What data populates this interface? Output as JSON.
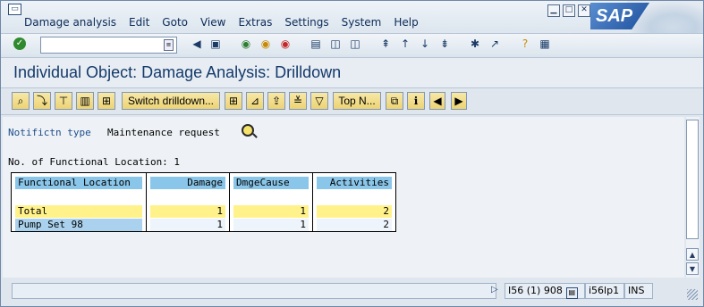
{
  "menu": [
    "Damage analysis",
    "Edit",
    "Goto",
    "View",
    "Extras",
    "Settings",
    "System",
    "Help"
  ],
  "window": {
    "minimize": "▁",
    "maximize": "□",
    "close": "✕"
  },
  "logo": "SAP",
  "title": "Individual Object: Damage Analysis: Drilldown",
  "toolbar": {
    "buttons": [
      "Switch drilldown...",
      "Top N..."
    ]
  },
  "notification": {
    "label": "Notifictn type",
    "value": "Maintenance request"
  },
  "count_text": "No. of Functional Location: 1",
  "table": {
    "headers": [
      "Functional Location",
      "Damage",
      "DmgeCause",
      "Activities"
    ],
    "rows": [
      {
        "label": "Total",
        "values": [
          "1",
          "1",
          "2"
        ]
      },
      {
        "label": "Pump Set 98",
        "values": [
          "1",
          "1",
          "2"
        ]
      }
    ]
  },
  "status": {
    "system": "I56 (1) 908",
    "server": "i56lp1",
    "mode": "INS"
  },
  "colors": {
    "header_blue": "#8ac6e9",
    "total_yellow": "#fff28a",
    "title_blue": "#153a6b"
  }
}
